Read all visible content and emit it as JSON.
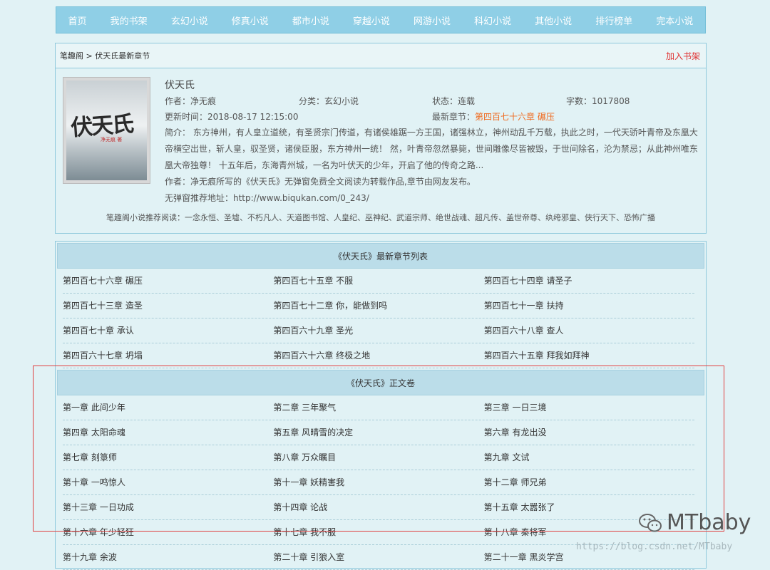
{
  "nav": [
    "首页",
    "我的书架",
    "玄幻小说",
    "修真小说",
    "都市小说",
    "穿越小说",
    "网游小说",
    "科幻小说",
    "其他小说",
    "排行榜单",
    "完本小说"
  ],
  "breadcrumb": {
    "site": "笔趣阁",
    "sep": ">",
    "page": "伏天氏最新章节"
  },
  "add_shelf": "加入书架",
  "book": {
    "cover_title": "伏天氏",
    "cover_author": "净无痕 著",
    "title": "伏天氏",
    "author": "作者：净无痕",
    "category": "分类：玄幻小说",
    "status": "状态：连载",
    "words": "字数：1017808",
    "updated": "更新时间：2018-08-17 12:15:00",
    "latest_label": "最新章节：",
    "latest_chapter": "第四百七十六章 碾压",
    "intro": "简介：  东方神州，有人皇立道统，有圣贤宗门传道，有诸侯雄踞一方王国，诸强林立，神州动乱千万载，执此之时，一代天骄叶青帝及东凰大帝横空出世，斩人皇，驭圣贤，诸侯臣服，东方神州一统！      然，叶青帝忽然暴毙，世间雕像尽皆被毁，于世间除名，沦为禁忌；从此神州唯东凰大帝独尊！      十五年后，东海青州城，一名为叶伏天的少年，开启了他的传奇之路...",
    "note": "作者：净无痕所写的《伏天氏》无弹窗免费全文阅读为转载作品,章节由网友发布。",
    "address": "无弹窗推荐地址：http://www.biqukan.com/0_243/"
  },
  "recommend": "笔趣阁小说推荐阅读：一念永恒、圣墟、不朽凡人、天道图书馆、人皇纪、巫神纪、武道宗师、绝世战魂、超凡传、盖世帝尊、纨绔邪皇、侠行天下、恐怖广播",
  "latest_section": {
    "title": "《伏天氏》最新章节列表",
    "rows": [
      [
        "第四百七十六章 碾压",
        "第四百七十五章 不服",
        "第四百七十四章 请圣子"
      ],
      [
        "第四百七十三章 造圣",
        "第四百七十二章 你，能做到吗",
        "第四百七十一章 扶持"
      ],
      [
        "第四百七十章 承认",
        "第四百六十九章 圣光",
        "第四百六十八章 查人"
      ],
      [
        "第四百六十七章 坍塌",
        "第四百六十六章 终极之地",
        "第四百六十五章 拜我如拜神"
      ]
    ]
  },
  "main_section": {
    "title": "《伏天氏》正文卷",
    "rows": [
      [
        "第一章 此间少年",
        "第二章 三年聚气",
        "第三章 一日三境"
      ],
      [
        "第四章 太阳命魂",
        "第五章 风晴雪的决定",
        "第六章 有龙出没"
      ],
      [
        "第七章 刻箓师",
        "第八章 万众瞩目",
        "第九章 文试"
      ],
      [
        "第十章 一鸣惊人",
        "第十一章 妖精害我",
        "第十二章 师兄弟"
      ],
      [
        "第十三章 一日功成",
        "第十四章 论战",
        "第十五章 太嚣张了"
      ],
      [
        "第十六章 年少轻狂",
        "第十七章 我不服",
        "第十八章 秦将军"
      ],
      [
        "第十九章 余波",
        "第二十章 引狼入室",
        "第二十一章 黑炎学宫"
      ]
    ]
  },
  "watermark": {
    "logo": "MTbaby",
    "url": "https://blog.csdn.net/MTbaby"
  },
  "colors": {
    "nav_bg": "#8fcfe6",
    "page_bg": "#e1f2f5",
    "section_head": "#bbdde9",
    "accent_red": "#e03030",
    "latest_orange": "#f06a1e"
  }
}
